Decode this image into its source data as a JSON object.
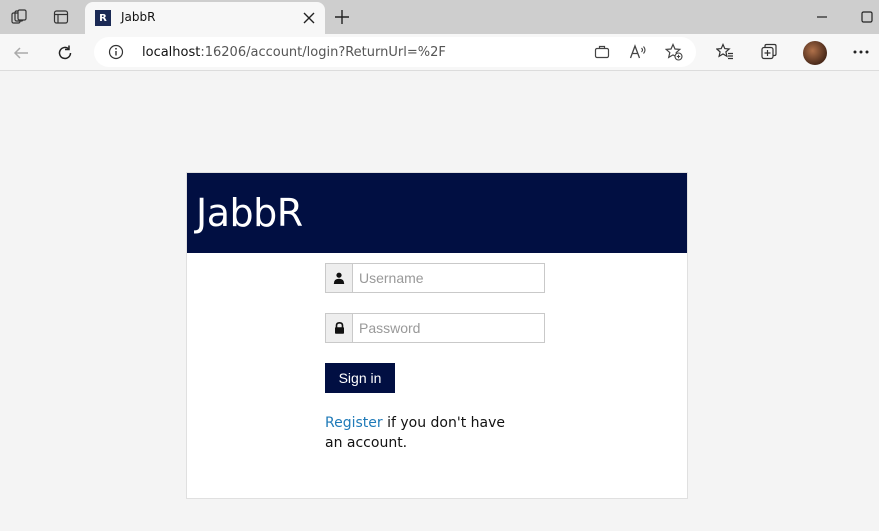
{
  "browser": {
    "tab": {
      "title": "JabbR",
      "favicon_letter": "R"
    },
    "address": {
      "host": "localhost",
      "rest": ":16206/account/login?ReturnUrl=%2F"
    },
    "icons": {
      "workspaces": "workspaces-icon",
      "tab_actions": "tab-actions-icon",
      "close_tab": "close-icon",
      "new_tab": "plus-icon",
      "minimize": "minimize-icon",
      "maximize": "maximize-icon",
      "back": "back-arrow-icon",
      "refresh": "refresh-icon",
      "info": "info-icon",
      "app_available": "app-available-icon",
      "read_aloud": "read-aloud-icon",
      "add_favorite": "add-favorite-icon",
      "favorites": "favorites-icon",
      "collections": "collections-icon",
      "menu": "more-menu-icon"
    }
  },
  "page": {
    "brand": "JabbR",
    "username": {
      "placeholder": "Username",
      "value": ""
    },
    "password": {
      "placeholder": "Password",
      "value": ""
    },
    "signin_label": "Sign in",
    "register_link": "Register",
    "register_suffix": " if you don't have an account."
  },
  "colors": {
    "header_bg": "#010f42",
    "button_bg": "#010f42",
    "link": "#1f7ab8",
    "page_bg": "#f4f4f4"
  }
}
